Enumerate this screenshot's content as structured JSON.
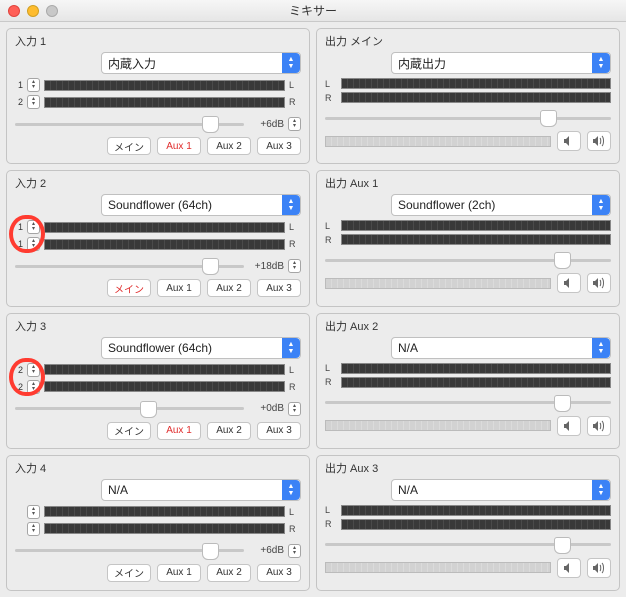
{
  "window": {
    "title": "ミキサー"
  },
  "inputs": [
    {
      "label": "入力 1",
      "device": "内蔵入力",
      "ch": [
        "1",
        "2"
      ],
      "gain": "+6dB",
      "thumb": 0.85,
      "highlight": false,
      "buttons": [
        {
          "label": "メイン",
          "red": false
        },
        {
          "label": "Aux 1",
          "red": true
        },
        {
          "label": "Aux 2",
          "red": false
        },
        {
          "label": "Aux 3",
          "red": false
        }
      ]
    },
    {
      "label": "入力 2",
      "device": "Soundflower (64ch)",
      "ch": [
        "1",
        "1"
      ],
      "gain": "+18dB",
      "thumb": 0.85,
      "highlight": true,
      "buttons": [
        {
          "label": "メイン",
          "red": true
        },
        {
          "label": "Aux 1",
          "red": false
        },
        {
          "label": "Aux 2",
          "red": false
        },
        {
          "label": "Aux 3",
          "red": false
        }
      ]
    },
    {
      "label": "入力 3",
      "device": "Soundflower (64ch)",
      "ch": [
        "2",
        "2"
      ],
      "gain": "+0dB",
      "thumb": 0.58,
      "highlight": true,
      "buttons": [
        {
          "label": "メイン",
          "red": false
        },
        {
          "label": "Aux 1",
          "red": true
        },
        {
          "label": "Aux 2",
          "red": false
        },
        {
          "label": "Aux 3",
          "red": false
        }
      ]
    },
    {
      "label": "入力 4",
      "device": "N/A",
      "ch": [
        "",
        ""
      ],
      "gain": "+6dB",
      "thumb": 0.85,
      "highlight": false,
      "buttons": [
        {
          "label": "メイン",
          "red": false
        },
        {
          "label": "Aux 1",
          "red": false
        },
        {
          "label": "Aux 2",
          "red": false
        },
        {
          "label": "Aux 3",
          "red": false
        }
      ]
    }
  ],
  "outputs": [
    {
      "label": "出力 メイン",
      "device": "内蔵出力",
      "thumb": 0.78
    },
    {
      "label": "出力 Aux 1",
      "device": "Soundflower (2ch)",
      "thumb": 0.83
    },
    {
      "label": "出力 Aux 2",
      "device": "N/A",
      "thumb": 0.83
    },
    {
      "label": "出力 Aux 3",
      "device": "N/A",
      "thumb": 0.83
    }
  ]
}
